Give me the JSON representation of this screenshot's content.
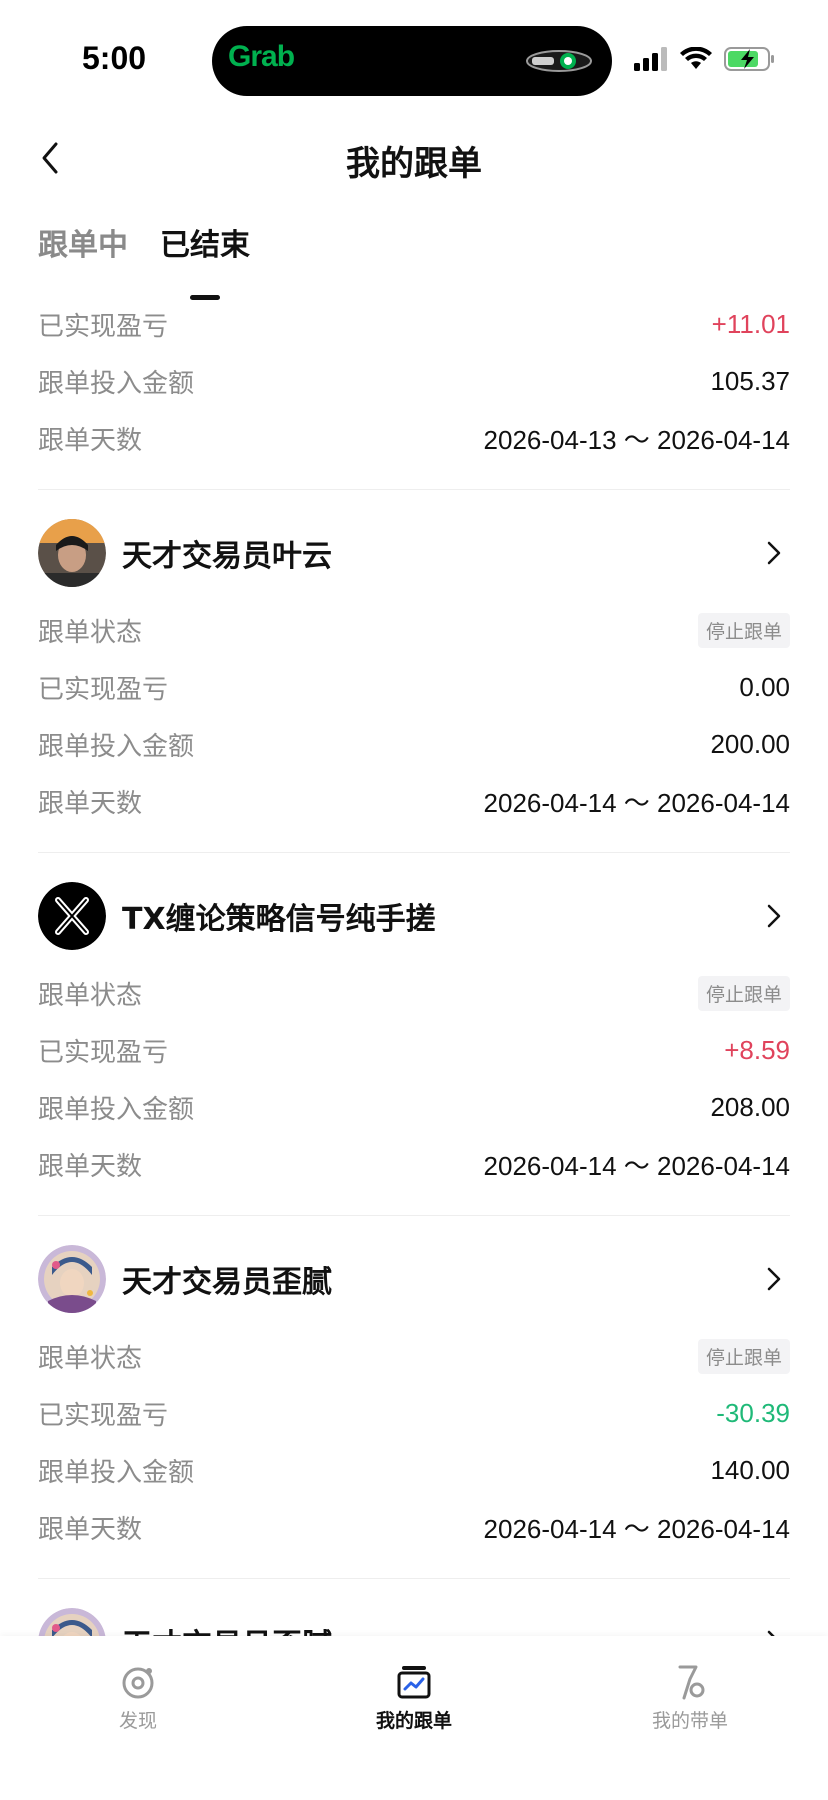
{
  "status_bar": {
    "time": "5:00",
    "island_app": "Grab"
  },
  "nav": {
    "title": "我的跟单"
  },
  "tabs": [
    {
      "label": "跟单中",
      "active": false
    },
    {
      "label": "已结束",
      "active": true
    }
  ],
  "partial_top": {
    "rows": [
      {
        "label": "已实现盈亏",
        "value": "+11.01",
        "tone": "pos"
      },
      {
        "label": "跟单投入金额",
        "value": "105.37",
        "tone": "neutral"
      },
      {
        "label": "跟单天数",
        "value": "2026-04-13 ～ 2026-04-14",
        "tone": "neutral"
      }
    ]
  },
  "cards": [
    {
      "name": "天才交易员叶云",
      "avatar": "photo-avatar",
      "status_label": "跟单状态",
      "status": "停止跟单",
      "pnl_label": "已实现盈亏",
      "pnl": "0.00",
      "pnl_tone": "neutral",
      "amount_label": "跟单投入金额",
      "amount": "200.00",
      "days_label": "跟单天数",
      "days": "2026-04-14 ～ 2026-04-14"
    },
    {
      "name": "TX缠论策略信号纯手搓",
      "avatar": "x-logo-avatar",
      "status_label": "跟单状态",
      "status": "停止跟单",
      "pnl_label": "已实现盈亏",
      "pnl": "+8.59",
      "pnl_tone": "pos",
      "amount_label": "跟单投入金额",
      "amount": "208.00",
      "days_label": "跟单天数",
      "days": "2026-04-14 ～ 2026-04-14"
    },
    {
      "name": "天才交易员歪腻",
      "avatar": "anime-avatar",
      "status_label": "跟单状态",
      "status": "停止跟单",
      "pnl_label": "已实现盈亏",
      "pnl": "-30.39",
      "pnl_tone": "neg",
      "amount_label": "跟单投入金额",
      "amount": "140.00",
      "days_label": "跟单天数",
      "days": "2026-04-14 ～ 2026-04-14"
    },
    {
      "name": "天才交易员歪腻",
      "avatar": "anime-avatar",
      "status_label": "",
      "status": "",
      "pnl_label": "",
      "pnl": "",
      "pnl_tone": "neutral",
      "amount_label": "",
      "amount": "",
      "days_label": "",
      "days": ""
    }
  ],
  "bottom_nav": [
    {
      "label": "发现",
      "icon": "discover-icon",
      "active": false
    },
    {
      "label": "我的跟单",
      "icon": "my-copy-icon",
      "active": true
    },
    {
      "label": "我的带单",
      "icon": "my-lead-icon",
      "active": false
    }
  ],
  "colors": {
    "positive": "#e0435c",
    "negative": "#1fb978",
    "label": "#8c8c8c",
    "grab_green": "#00b14f"
  }
}
